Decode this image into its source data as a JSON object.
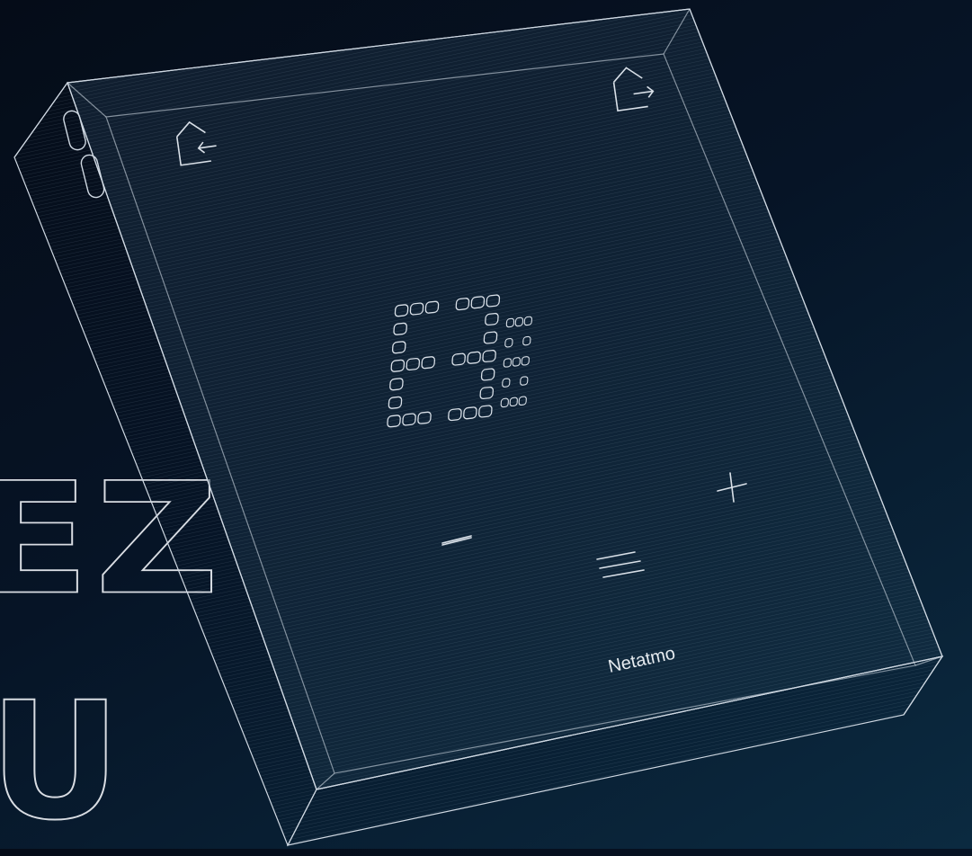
{
  "background_text": {
    "line1": "EZ",
    "line2": "U"
  },
  "device": {
    "brand": "Netatmo",
    "minus_symbol": "−",
    "plus_symbol": "+",
    "exit_home_icon": "home-arrow-in-icon",
    "enter_home_icon": "home-arrow-out-icon",
    "menu_icon": "menu-lines-icon"
  },
  "colors": {
    "background_dark": "#050c18",
    "background_light": "#0b2a40",
    "line": "#cfd8e2",
    "text": "#e6ebf0"
  }
}
